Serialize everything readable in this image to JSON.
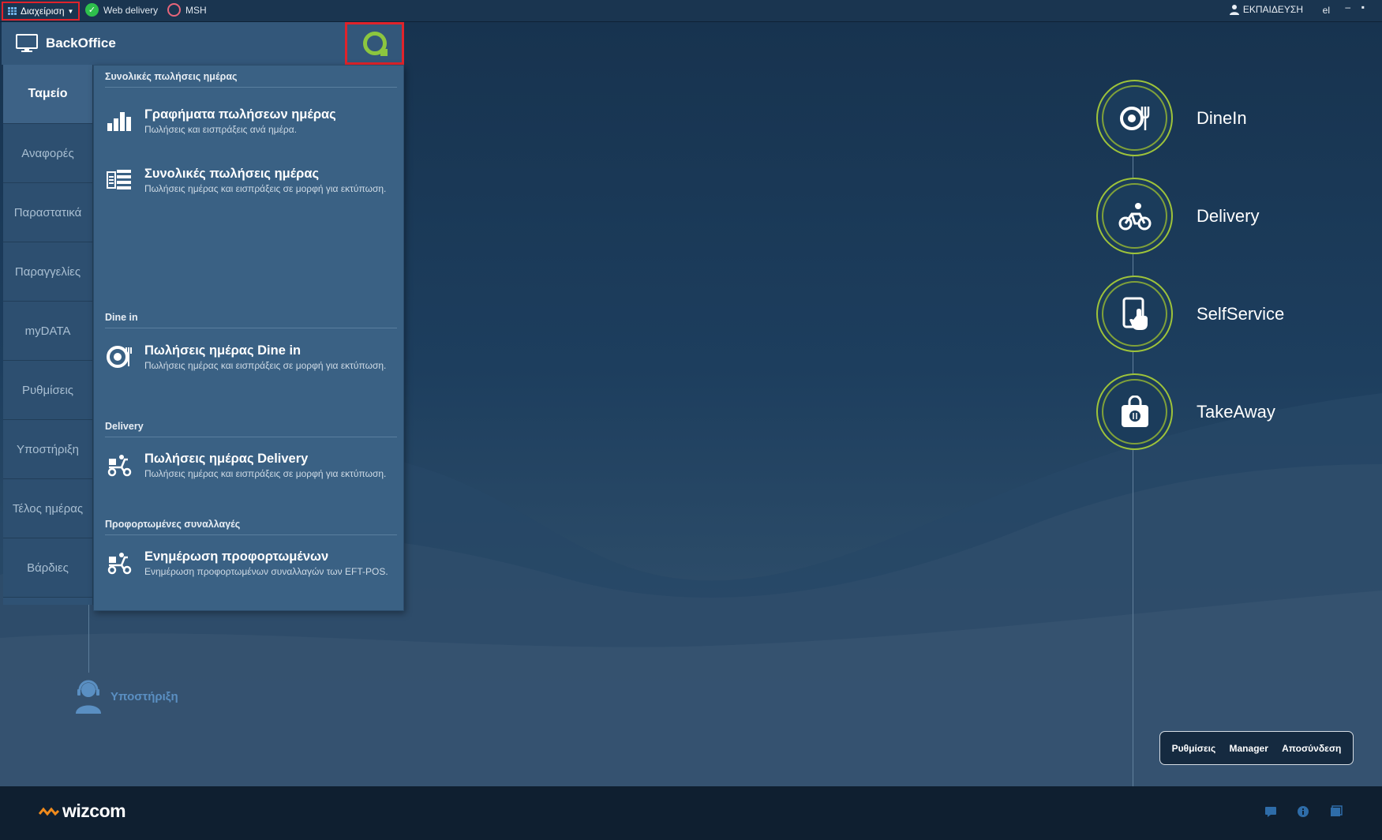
{
  "topbar": {
    "menu_label": "Διαχείριση",
    "web_delivery_label": "Web delivery",
    "msh_label": "MSH",
    "user_label": "ΕΚΠΑΙΔΕΥΣΗ",
    "lang_label": "el"
  },
  "backoffice": {
    "title": "BackOffice",
    "tabs": [
      {
        "label": "Ταμείο",
        "active": true
      },
      {
        "label": "Αναφορές"
      },
      {
        "label": "Παραστατικά"
      },
      {
        "label": "Παραγγελίες"
      },
      {
        "label": "myDATA"
      },
      {
        "label": "Ρυθμίσεις"
      },
      {
        "label": "Υποστήριξη"
      },
      {
        "label": "Τέλος ημέρας"
      },
      {
        "label": "Βάρδιες"
      }
    ],
    "sections": [
      {
        "title": "Συνολικές πωλήσεις ημέρας"
      },
      {
        "title": "Dine in"
      },
      {
        "title": "Delivery"
      },
      {
        "title": "Προφορτωμένες συναλλαγές"
      }
    ],
    "items": [
      {
        "title": "Γραφήματα πωλήσεων ημέρας",
        "desc": "Πωλήσεις και εισπράξεις ανά ημέρα.",
        "icon": "bar-chart-icon"
      },
      {
        "title": "Συνολικές πωλήσεις ημέρας",
        "desc": "Πωλήσεις ημέρας και εισπράξεις σε μορφή για εκτύπωση.",
        "icon": "report-list-icon"
      },
      {
        "title": "Πωλήσεις ημέρας Dine in",
        "desc": "Πωλήσεις ημέρας και εισπράξεις σε μορφή για εκτύπωση.",
        "icon": "dine-in-icon"
      },
      {
        "title": "Πωλήσεις ημέρας Delivery",
        "desc": "Πωλήσεις ημέρας και εισπράξεις σε μορφή για εκτύπωση.",
        "icon": "scooter-icon"
      },
      {
        "title": "Ενημέρωση προφορτωμένων",
        "desc": "Ενημέρωση προφορτωμένων συναλλαγών των EFT-POS.",
        "icon": "scooter-icon"
      }
    ]
  },
  "support": {
    "label": "Υποστήριξη"
  },
  "modes": [
    {
      "label": "DineIn",
      "icon": "plate-cutlery-icon"
    },
    {
      "label": "Delivery",
      "icon": "bicycle-icon"
    },
    {
      "label": "SelfService",
      "icon": "touch-tablet-icon"
    },
    {
      "label": "TakeAway",
      "icon": "takeaway-bag-icon"
    }
  ],
  "bottom_buttons": {
    "settings": "Ρυθμίσεις",
    "manager": "Manager",
    "logout": "Αποσύνδεση"
  },
  "footer": {
    "logo": "wizcom"
  },
  "colors": {
    "accent_green": "#9ec33a",
    "highlight_red": "#e0232b",
    "panel_blue": "#3a6184"
  }
}
